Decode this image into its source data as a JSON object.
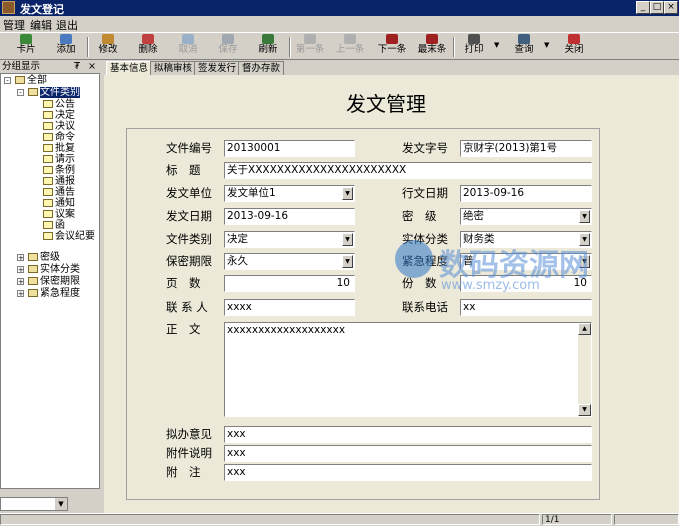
{
  "window": {
    "title": "发文登记"
  },
  "menu": [
    "管理",
    "编辑",
    "退出"
  ],
  "toolbar": {
    "items": [
      {
        "label": "卡片",
        "icon": "card-icon",
        "color": "#3a8a3a",
        "enabled": true
      },
      {
        "label": "添加",
        "icon": "add-icon",
        "color": "#4a7ac0",
        "enabled": true
      },
      {
        "label": "修改",
        "icon": "edit-icon",
        "color": "#c08a30",
        "enabled": true
      },
      {
        "label": "删除",
        "icon": "delete-icon",
        "color": "#c04040",
        "enabled": true
      },
      {
        "label": "取消",
        "icon": "cancel-icon",
        "color": "#9ab0c8",
        "enabled": false
      },
      {
        "label": "保存",
        "icon": "save-icon",
        "color": "#a0a8b0",
        "enabled": false
      },
      {
        "label": "刷新",
        "icon": "refresh-icon",
        "color": "#3a7a3a",
        "enabled": true
      },
      {
        "label": "第一条",
        "icon": "first-icon",
        "color": "#b0b0b0",
        "enabled": false
      },
      {
        "label": "上一条",
        "icon": "prev-icon",
        "color": "#b0b0b0",
        "enabled": false
      },
      {
        "label": "下一条",
        "icon": "next-icon",
        "color": "#a02020",
        "enabled": true
      },
      {
        "label": "最末条",
        "icon": "last-icon",
        "color": "#a02020",
        "enabled": true
      },
      {
        "label": "打印",
        "icon": "print-icon",
        "color": "#505050",
        "enabled": true
      },
      {
        "label": "查询",
        "icon": "query-icon",
        "color": "#406080",
        "enabled": true
      },
      {
        "label": "关闭",
        "icon": "close-icon",
        "color": "#c03030",
        "enabled": true
      }
    ]
  },
  "leftpanel": {
    "header": "分组显示",
    "tree": {
      "root": "全部",
      "category": "文件类别",
      "category_children": [
        "公告",
        "决定",
        "决议",
        "命令",
        "批复",
        "请示",
        "条例",
        "通报",
        "通告",
        "通知",
        "议案",
        "函",
        "会议纪要"
      ],
      "other_groups": [
        "密级",
        "实体分类",
        "保密期限",
        "紧急程度"
      ]
    }
  },
  "tabs": [
    "基本信息",
    "拟稿审核",
    "签发发行",
    "督办存款"
  ],
  "form": {
    "title": "发文管理",
    "labels": {
      "doc_no": "文件编号",
      "doc_word": "发文字号",
      "subject": "标　题",
      "unit": "发文单位",
      "issue_date": "行文日期",
      "send_date": "发文日期",
      "secret": "密　级",
      "file_type": "文件类别",
      "entity": "实体分类",
      "keep": "保密期限",
      "urgency": "紧急程度",
      "pages": "页　数",
      "copies": "份　数",
      "contact": "联 系 人",
      "phone": "联系电话",
      "body": "正　文",
      "opinion": "拟办意见",
      "attach": "附件说明",
      "remark": "附　注"
    },
    "values": {
      "doc_no": "20130001",
      "doc_word": "京财字(2013)第1号",
      "subject": "关于XXXXXXXXXXXXXXXXXXXXXX",
      "unit": "发文单位1",
      "issue_date": "2013-09-16",
      "send_date": "2013-09-16",
      "secret": "绝密",
      "file_type": "决定",
      "entity": "财务类",
      "keep": "永久",
      "urgency": "普",
      "pages": "10",
      "copies": "10",
      "contact": "xxxx",
      "phone": "xx",
      "body": "xxxxxxxxxxxxxxxxxxx",
      "opinion": "xxx",
      "attach": "xxx",
      "remark": "xxx"
    }
  },
  "watermark": {
    "text": "数码资源网",
    "url": "www.smzy.com"
  },
  "status": {
    "record": "1/1"
  }
}
